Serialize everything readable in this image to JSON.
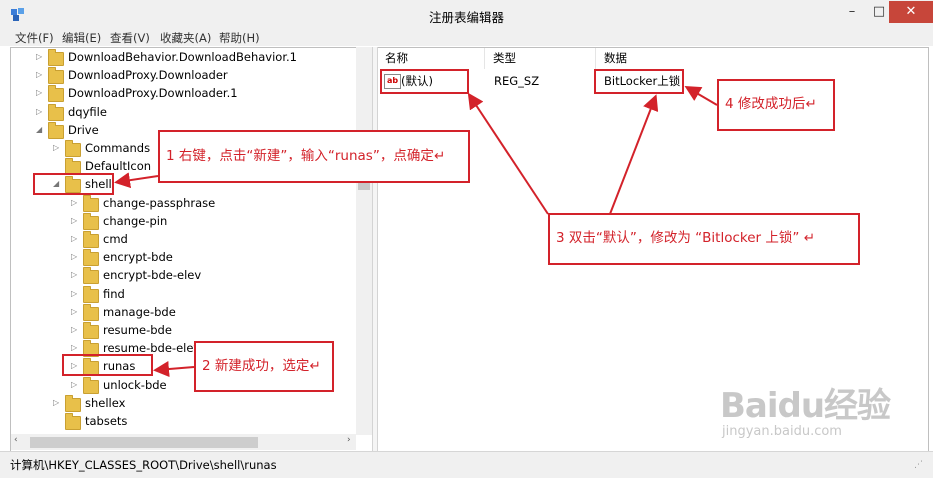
{
  "window": {
    "title": "注册表编辑器",
    "minimize": "–",
    "maximize": "□",
    "close": "✕"
  },
  "menu": [
    "文件(F)",
    "编辑(E)",
    "查看(V)",
    "收藏夹(A)",
    "帮助(H)"
  ],
  "tree": [
    {
      "label": "DownloadBehavior.DownloadBehavior.1",
      "level": 1,
      "expander": "▷"
    },
    {
      "label": "DownloadProxy.Downloader",
      "level": 1,
      "expander": "▷"
    },
    {
      "label": "DownloadProxy.Downloader.1",
      "level": 1,
      "expander": "▷"
    },
    {
      "label": "dqyfile",
      "level": 1,
      "expander": "▷"
    },
    {
      "label": "Drive",
      "level": 1,
      "expander": "◢"
    },
    {
      "label": "Commands",
      "level": 2,
      "expander": "▷"
    },
    {
      "label": "DefaultIcon",
      "level": 2,
      "expander": ""
    },
    {
      "label": "shell",
      "level": 2,
      "expander": "◢"
    },
    {
      "label": "change-passphrase",
      "level": 3,
      "expander": "▷"
    },
    {
      "label": "change-pin",
      "level": 3,
      "expander": "▷"
    },
    {
      "label": "cmd",
      "level": 3,
      "expander": "▷"
    },
    {
      "label": "encrypt-bde",
      "level": 3,
      "expander": "▷"
    },
    {
      "label": "encrypt-bde-elev",
      "level": 3,
      "expander": "▷"
    },
    {
      "label": "find",
      "level": 3,
      "expander": "▷"
    },
    {
      "label": "manage-bde",
      "level": 3,
      "expander": "▷"
    },
    {
      "label": "resume-bde",
      "level": 3,
      "expander": "▷"
    },
    {
      "label": "resume-bde-elev",
      "level": 3,
      "expander": "▷"
    },
    {
      "label": "runas",
      "level": 3,
      "expander": "▷"
    },
    {
      "label": "unlock-bde",
      "level": 3,
      "expander": "▷"
    },
    {
      "label": "shellex",
      "level": 2,
      "expander": "▷"
    },
    {
      "label": "tabsets",
      "level": 2,
      "expander": ""
    }
  ],
  "list": {
    "headers": {
      "name": "名称",
      "type": "类型",
      "data": "数据"
    },
    "rows": [
      {
        "name": "(默认)",
        "icon": "ab-string-icon",
        "type": "REG_SZ",
        "data": "BitLocker上锁"
      }
    ]
  },
  "status": {
    "path": "计算机\\HKEY_CLASSES_ROOT\\Drive\\shell\\runas"
  },
  "annotations": {
    "step1": "1 右键，点击“新建”，输入“runas”，点确定↵",
    "step2": "2 新建成功，选定↵",
    "step3": "3 双击“默认”，修改为 “Bitlocker 上锁” ↵",
    "step4": "4 修改成功后↵"
  },
  "watermark": {
    "brand": "Baidu经验",
    "url": "jingyan.baidu.com"
  },
  "colors": {
    "annotation": "#d3222a",
    "folder": "#e8c04a",
    "close_button": "#c7463a"
  }
}
